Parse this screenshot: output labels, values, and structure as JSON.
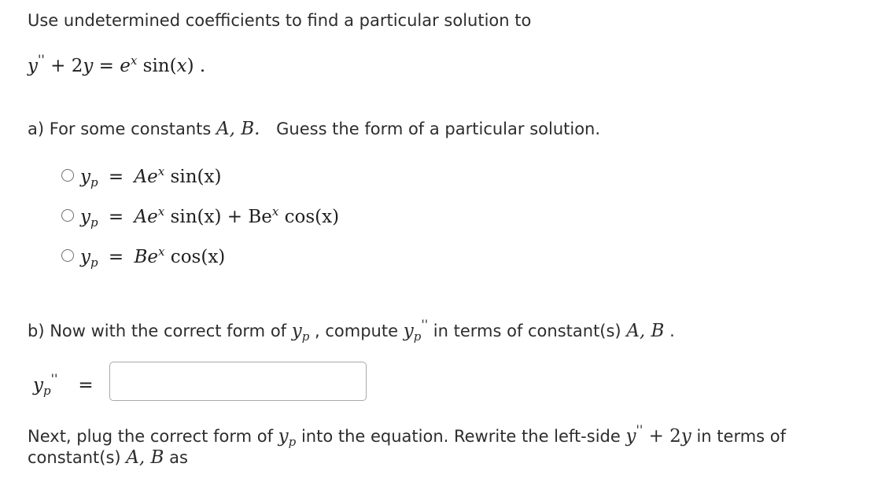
{
  "intro": {
    "instruction": "Use undetermined coefficients to find a particular solution to",
    "equation": {
      "lhs_y": "y",
      "lhs_primes": "''",
      "lhs_rest": " + 2",
      "lhs_y2": "y",
      "equals": " = ",
      "rhs_e": "e",
      "rhs_sup": "x",
      "rhs_fn": " sin(",
      "rhs_arg": "x",
      "rhs_close": ") ."
    }
  },
  "part_a": {
    "prompt_start": "a) For some constants ",
    "constants": "A, B.",
    "prompt_end": "Guess the form of a particular solution.",
    "options": [
      {
        "yp": "y",
        "yp_sub": "p",
        "eq": " = ",
        "body": "Ae",
        "sup": "x",
        "rest": " sin(x)"
      },
      {
        "yp": "y",
        "yp_sub": "p",
        "eq": " = ",
        "body": "Ae",
        "sup": "x",
        "rest": " sin(x) + Be",
        "sup2": "x",
        "rest2": " cos(x)"
      },
      {
        "yp": "y",
        "yp_sub": "p",
        "eq": " = ",
        "body": "Be",
        "sup": "x",
        "rest": " cos(x)"
      }
    ]
  },
  "part_b": {
    "prompt_start": "b) Now with the correct form of ",
    "yp": "y",
    "yp_sub": "p",
    "comma": " , compute ",
    "yp2": "y",
    "yp2_sub": "p",
    "primes": "''",
    "prompt_mid": " in terms of constant(s) ",
    "constants": "A, B",
    "period": " .",
    "answer_label_y": "y",
    "answer_label_sub": "p",
    "answer_label_primes": "''",
    "answer_label_eq": "=",
    "answer_value": ""
  },
  "next": {
    "line1_start": "Next, plug the correct form of ",
    "yp": "y",
    "yp_sub": "p",
    "line1_mid": " into the equation. Rewrite the left-side ",
    "lhs_y": "y",
    "lhs_primes": "''",
    "lhs_rest": " + 2",
    "lhs_y2": "y",
    "line1_end": " in terms of",
    "line2_start": "constant(s) ",
    "constants": "A, B",
    "line2_end": " as"
  }
}
